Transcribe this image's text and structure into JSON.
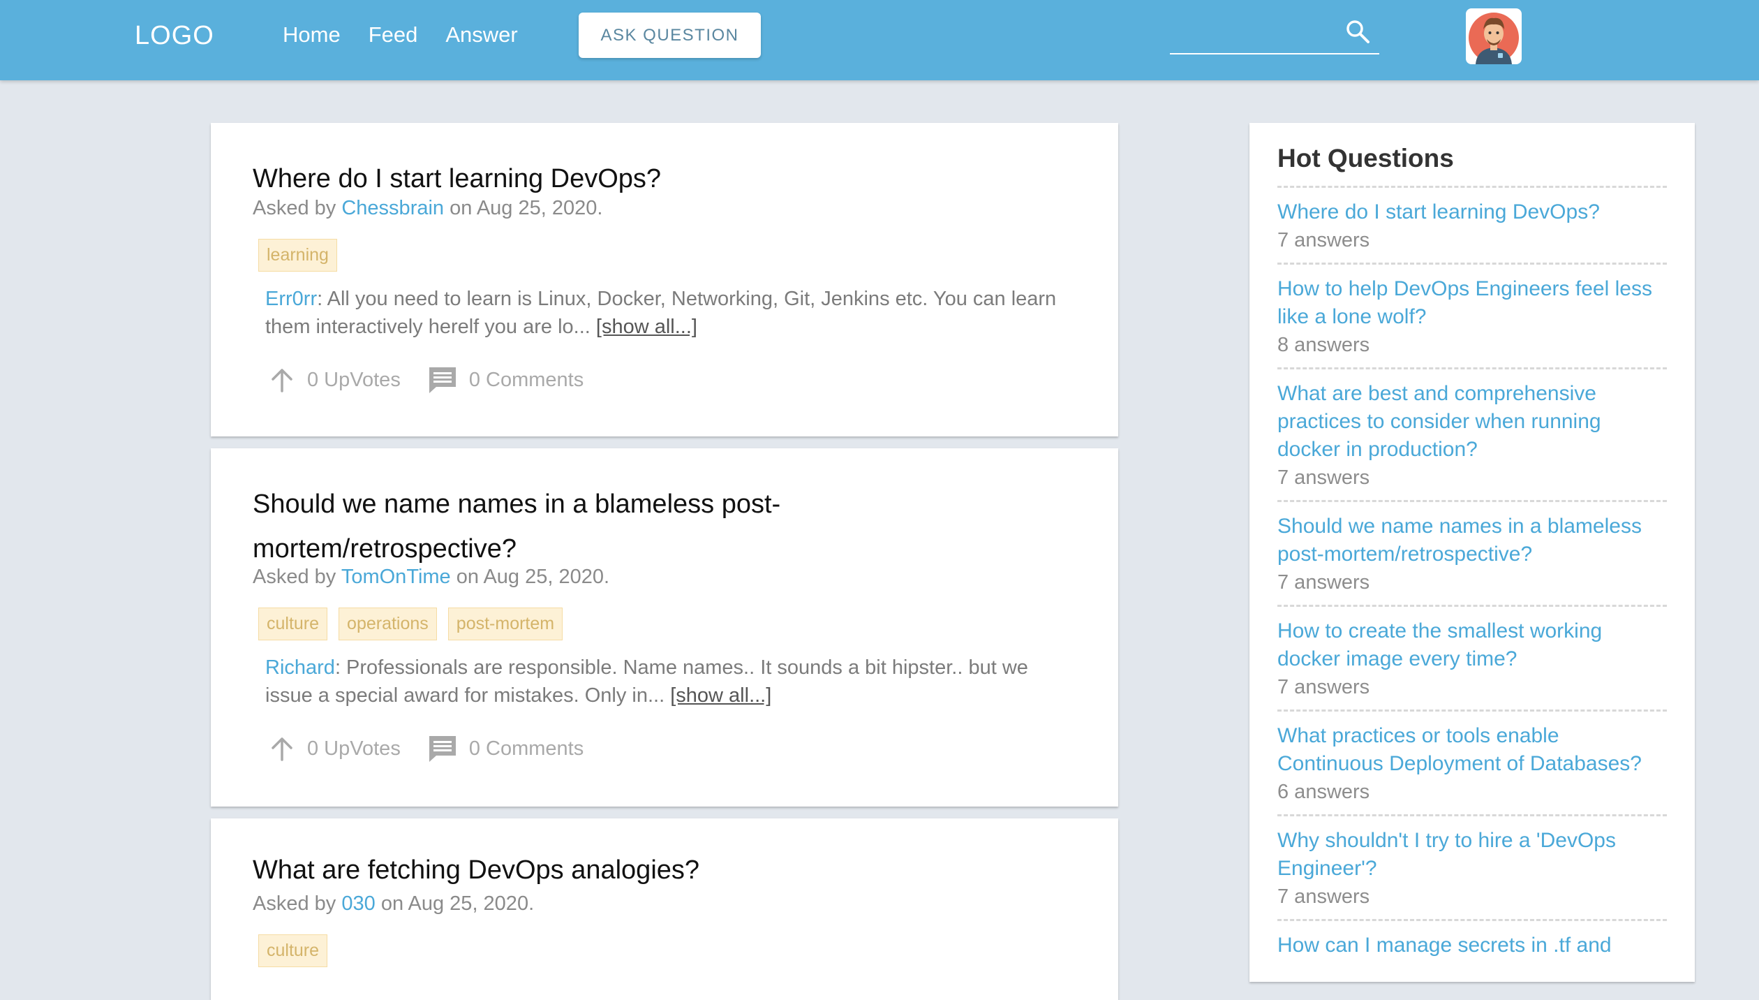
{
  "header": {
    "logo": "LOGO",
    "nav": [
      "Home",
      "Feed",
      "Answer"
    ],
    "ask_button": "ASK QUESTION",
    "search": {
      "value": "",
      "placeholder": ""
    },
    "colors": {
      "bar": "#5ab0dc",
      "link": "#4aa8d8",
      "tag_bg": "#fdf1d6"
    },
    "icons": {
      "search": "search-icon",
      "avatar": "user-avatar"
    }
  },
  "questions": [
    {
      "title": "Where do I start learning DevOps?",
      "asked_prefix": "Asked by",
      "user": "Chessbrain",
      "date_text": "on Aug 25, 2020.",
      "tags": [
        "learning"
      ],
      "answer_user": "Err0rr",
      "answer_text": ": All you need to learn is Linux, Docker, Networking, Git, Jenkins etc. You can learn them interactively herelf you are lo... ",
      "show_all": "[show all...]",
      "upvotes": "0 UpVotes",
      "comments": "0 Comments"
    },
    {
      "title": "Should we name names in a blameless post-mortem/retrospective?",
      "asked_prefix": "Asked by",
      "user": "TomOnTime",
      "date_text": "on Aug 25, 2020.",
      "tags": [
        "culture",
        "operations",
        "post-mortem"
      ],
      "answer_user": "Richard",
      "answer_text": ": Professionals are responsible. Name names.. It sounds a bit hipster.. but we issue a special award for mistakes. Only in... ",
      "show_all": "[show all...]",
      "upvotes": "0 UpVotes",
      "comments": "0 Comments"
    },
    {
      "title": "What are fetching DevOps analogies?",
      "asked_prefix": "Asked by",
      "user": "030",
      "date_text": "on Aug 25, 2020.",
      "tags": [
        "culture"
      ]
    }
  ],
  "hot": {
    "title": "Hot Questions",
    "items": [
      {
        "question": "Where do I start learning DevOps?",
        "answers": "7 answers"
      },
      {
        "question": "How to help DevOps Engineers feel less like a lone wolf?",
        "answers": "8 answers"
      },
      {
        "question": "What are best and comprehensive practices to consider when running docker in production?",
        "answers": "7 answers"
      },
      {
        "question": "Should we name names in a blameless post-mortem/retrospective?",
        "answers": "7 answers"
      },
      {
        "question": "How to create the smallest working docker image every time?",
        "answers": "7 answers"
      },
      {
        "question": "What practices or tools enable Continuous Deployment of Databases?",
        "answers": "6 answers"
      },
      {
        "question": "Why shouldn't I try to hire a 'DevOps Engineer'?",
        "answers": "7 answers"
      },
      {
        "question": "How can I manage secrets in .tf and",
        "answers": ""
      }
    ]
  }
}
